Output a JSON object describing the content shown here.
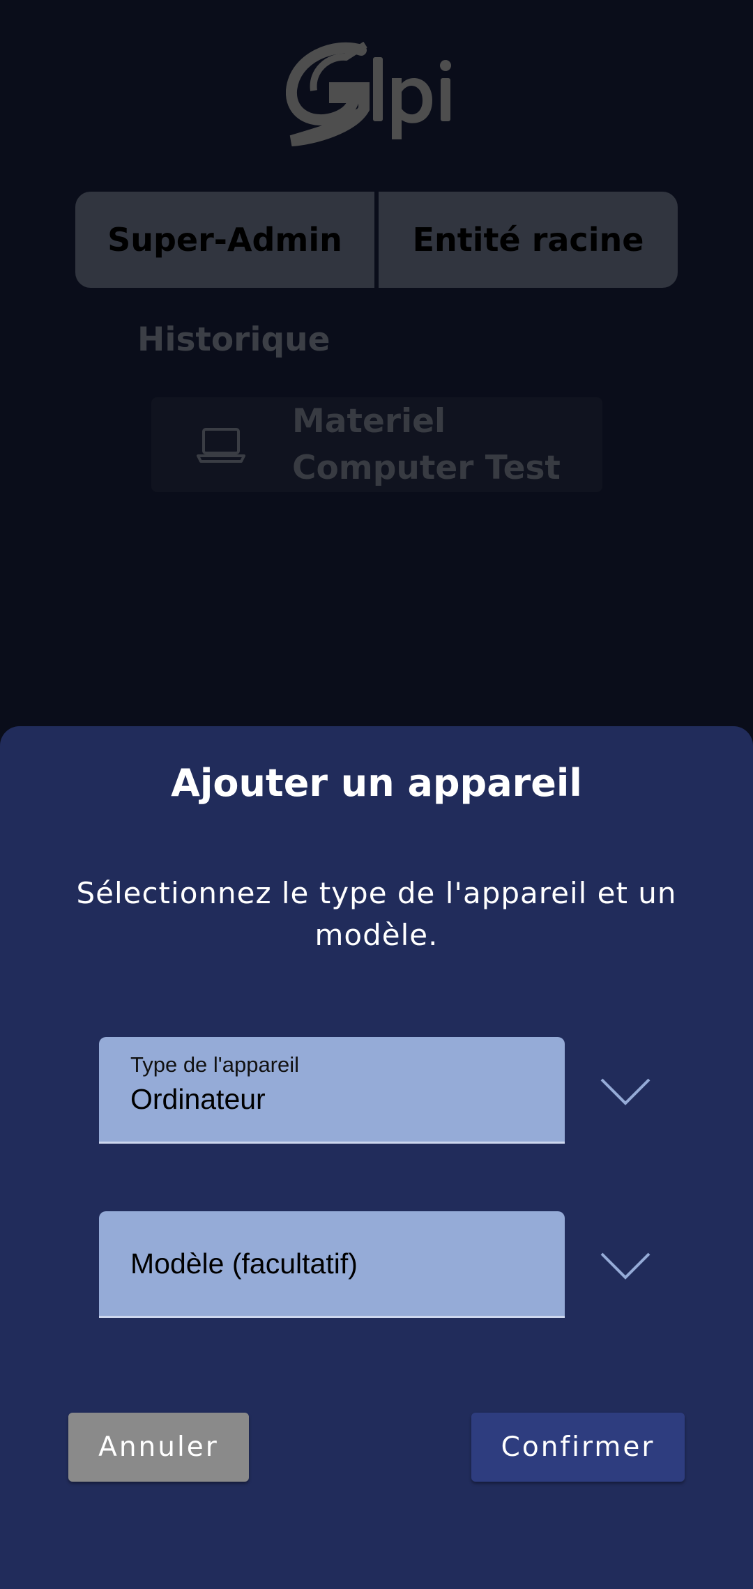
{
  "background": {
    "logo_alt": "Glpi",
    "profile": {
      "role": "Super-Admin",
      "entity": "Entité racine"
    },
    "history": {
      "title": "Historique",
      "items": [
        {
          "icon": "laptop-icon",
          "line1": "Materiel",
          "line2": "Computer Test"
        }
      ]
    }
  },
  "dialog": {
    "title": "Ajouter un appareil",
    "description": "Sélectionnez le type de l'appareil et un modèle.",
    "device_type": {
      "label": "Type de l'appareil",
      "value": "Ordinateur",
      "icon": "chevron-down-icon"
    },
    "model": {
      "placeholder": "Modèle (facultatif)",
      "value": "",
      "icon": "chevron-down-icon"
    },
    "cancel_label": "Annuler",
    "confirm_label": "Confirmer"
  },
  "colors": {
    "background": "#0a0d1a",
    "sheet": "#212c5b",
    "field": "#95abd7",
    "cancel": "#8a8a8a",
    "confirm": "#2e3d7f"
  }
}
